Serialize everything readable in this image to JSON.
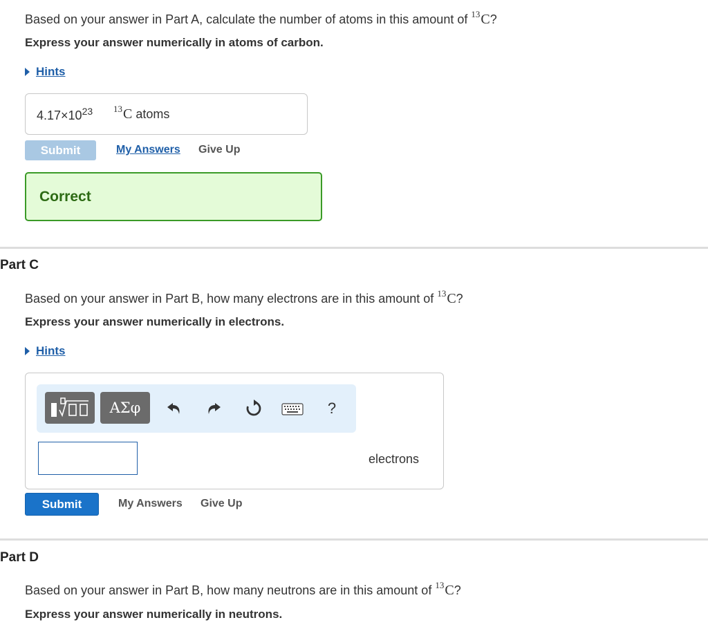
{
  "partB": {
    "question_prefix": "Based on your answer in Part A, calculate the number of atoms in this amount of",
    "question_suffix": "?",
    "isotope_mass": "13",
    "isotope_symbol": "C",
    "instruction": "Express your answer numerically in atoms of carbon.",
    "hints_label": "Hints",
    "answer_mantissa": "4.17×10",
    "answer_exponent": "23",
    "answer_unit_mass": "13",
    "answer_unit_symbol": "C",
    "answer_unit_word": "atoms",
    "submit_label": "Submit",
    "my_answers_label": "My Answers",
    "give_up_label": "Give Up",
    "feedback": "Correct"
  },
  "partC": {
    "title": "Part C",
    "question_prefix": "Based on your answer in Part B, how many electrons are in this amount of",
    "question_suffix": "?",
    "isotope_mass": "13",
    "isotope_symbol": "C",
    "instruction": "Express your answer numerically in electrons.",
    "hints_label": "Hints",
    "toolbar": {
      "greek_label": "ΑΣφ",
      "help_label": "?"
    },
    "answer_value": "",
    "unit_label": "electrons",
    "submit_label": "Submit",
    "my_answers_label": "My Answers",
    "give_up_label": "Give Up"
  },
  "partD": {
    "title": "Part D",
    "question_prefix": "Based on your answer in Part B, how many neutrons are in this amount of",
    "question_suffix": "?",
    "isotope_mass": "13",
    "isotope_symbol": "C",
    "instruction": "Express your answer numerically in neutrons."
  },
  "colors": {
    "link_blue": "#1f5fa8",
    "submit_active": "#1a73c9",
    "submit_disabled": "#a9c8e3",
    "correct_bg": "#e4fbd8",
    "correct_border": "#3a9a27",
    "correct_text": "#2d6b14",
    "toolbar_bg": "#e3f0fb"
  }
}
